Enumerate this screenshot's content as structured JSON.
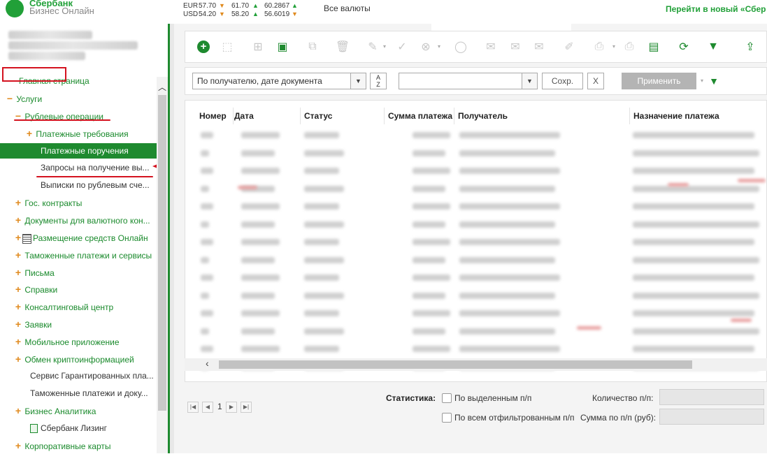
{
  "header": {
    "logo_line1": "Сбербанк",
    "logo_line2": "Бизнес Онлайн",
    "rates": [
      {
        "currency": "EUR",
        "v1": "57.70",
        "d1": "▼",
        "v2": "61.70",
        "d2": "▲",
        "v3": "60.2867",
        "d3": "▲"
      },
      {
        "currency": "USD",
        "v1": "54.20",
        "d1": "▼",
        "v2": "58.20",
        "d2": "▲",
        "v3": "56.6019",
        "d3": "▼"
      }
    ],
    "all_currencies": "Все валюты",
    "goto_new": "Перейти в новый «Сбер"
  },
  "sidebar": {
    "items": [
      {
        "label": "Главная страница"
      },
      {
        "label": "Услуги",
        "marker": "−"
      },
      {
        "label": "Рублевые операции",
        "marker": "−"
      },
      {
        "label": "Платежные требования",
        "marker": "+"
      },
      {
        "label": "Платежные поручения"
      },
      {
        "label": "Запросы на получение вы..."
      },
      {
        "label": "Выписки по рублевым сче..."
      },
      {
        "label": "Гос. контракты",
        "marker": "+"
      },
      {
        "label": "Документы для валютного кон...",
        "marker": "+"
      },
      {
        "label": "Размещение средств Онлайн",
        "marker": "+"
      },
      {
        "label": "Таможенные платежи и сервисы",
        "marker": "+"
      },
      {
        "label": "Письма",
        "marker": "+"
      },
      {
        "label": "Справки",
        "marker": "+"
      },
      {
        "label": "Консалтинговый центр",
        "marker": "+"
      },
      {
        "label": "Заявки",
        "marker": "+"
      },
      {
        "label": "Мобильное приложение",
        "marker": "+"
      },
      {
        "label": "Обмен криптоинформацией",
        "marker": "+"
      },
      {
        "label": "Сервис Гарантированных пла..."
      },
      {
        "label": "Таможенные платежи и доку..."
      },
      {
        "label": "Бизнес Аналитика",
        "marker": "+"
      },
      {
        "label": "Сбербанк Лизинг"
      },
      {
        "label": "Корпоративные карты",
        "marker": "+"
      }
    ]
  },
  "filter": {
    "sort_value": "По получателю, дате документа",
    "sort_btn": "A\nZ",
    "save_label": "Сохр.",
    "clear_label": "X",
    "apply_label": "Применить"
  },
  "grid": {
    "columns": [
      "Номер",
      "Дата",
      "Статус",
      "Сумма платежа",
      "Получатель",
      "Назначение платежа"
    ]
  },
  "pager": {
    "page": "1"
  },
  "stats": {
    "title": "Статистика:",
    "by_selected": "По выделенным п/п",
    "by_filtered": "По всем отфильтрованным п/п",
    "count_label": "Количество п/п:",
    "sum_label": "Сумма по п/п (руб):"
  },
  "colors": {
    "brand_green": "#1e8a2f",
    "accent_orange": "#e08a1e",
    "annotation_red": "#d4121f"
  }
}
